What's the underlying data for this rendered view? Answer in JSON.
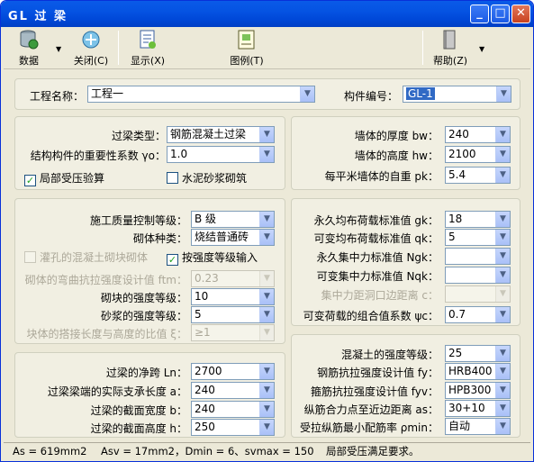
{
  "window": {
    "title": "GL 过 梁"
  },
  "toolbar": {
    "data_label": "数据",
    "close_label": "关闭(C)",
    "display_label": "显示(X)",
    "legend_label": "图例(T)",
    "help_label": "帮助(Z)"
  },
  "project": {
    "name_label": "工程名称：",
    "name_value": "工程一",
    "code_label": "构件编号：",
    "code_value": "GL-1"
  },
  "beam_type": {
    "type_label": "过梁类型：",
    "type_value": "钢筋混凝土过梁",
    "importance_label": "结构构件的重要性系数 γo：",
    "importance_value": "1.0",
    "local_pressure_label": "局部受压验算",
    "local_pressure_checked": "✓",
    "cement_mortar_label": "水泥砂浆砌筑",
    "cement_mortar_checked": ""
  },
  "wall": {
    "thickness_label": "墙体的厚度 bw：",
    "thickness_value": "240",
    "height_label": "墙体的高度 hw：",
    "height_value": "2100",
    "weight_label": "每平米墙体的自重 pk：",
    "weight_value": "5.4"
  },
  "masonry": {
    "quality_label": "施工质量控制等级：",
    "quality_value": "B 级",
    "type_label": "砌体种类：",
    "type_value": "烧结普通砖",
    "grouted_label": "灌孔的混凝土砌块砌体",
    "grouted_checked": "",
    "by_grade_label": "按强度等级输入",
    "by_grade_checked": "✓",
    "ftm_label": "砌体的弯曲抗拉强度设计值 ftm：",
    "ftm_value": "0.23",
    "block_grade_label": "砌块的强度等级：",
    "block_grade_value": "10",
    "mortar_grade_label": "砂浆的强度等级：",
    "mortar_grade_value": "5",
    "overlap_label": "块体的搭接长度与高度的比值 ξ：",
    "overlap_value": "≥1"
  },
  "loads": {
    "gk_label": "永久均布荷载标准值 gk：",
    "gk_value": "18",
    "qk_label": "可变均布荷载标准值 qk：",
    "qk_value": "5",
    "Ngk_label": "永久集中力标准值 Ngk：",
    "Ngk_value": "",
    "Nqk_label": "可变集中力标准值 Nqk：",
    "Nqk_value": "",
    "c_label": "集中力距洞口边距离 c：",
    "c_value": "",
    "psi_label": "可变荷载的组合值系数 ψc：",
    "psi_value": "0.7"
  },
  "geometry": {
    "ln_label": "过梁的净跨 Ln：",
    "ln_value": "2700",
    "a_label": "过梁梁端的实际支承长度 a：",
    "a_value": "240",
    "b_label": "过梁的截面宽度 b：",
    "b_value": "240",
    "h_label": "过梁的截面高度 h：",
    "h_value": "250"
  },
  "concrete": {
    "grade_label": "混凝土的强度等级：",
    "grade_value": "25",
    "fy_label": "钢筋抗拉强度设计值 fy：",
    "fy_value": "HRB400",
    "fyv_label": "箍筋抗拉强度设计值 fyv：",
    "fyv_value": "HPB300",
    "as_label": "纵筋合力点至近边距离 as：",
    "as_value": "30+10",
    "pmin_label": "受拉纵筋最小配筋率 ρmin：",
    "pmin_value": "自动"
  },
  "status": {
    "as": "As = 619mm2",
    "asv": "Asv = 17mm2，Dmin = 6、svmax = 150",
    "msg": "局部受压满足要求。"
  }
}
